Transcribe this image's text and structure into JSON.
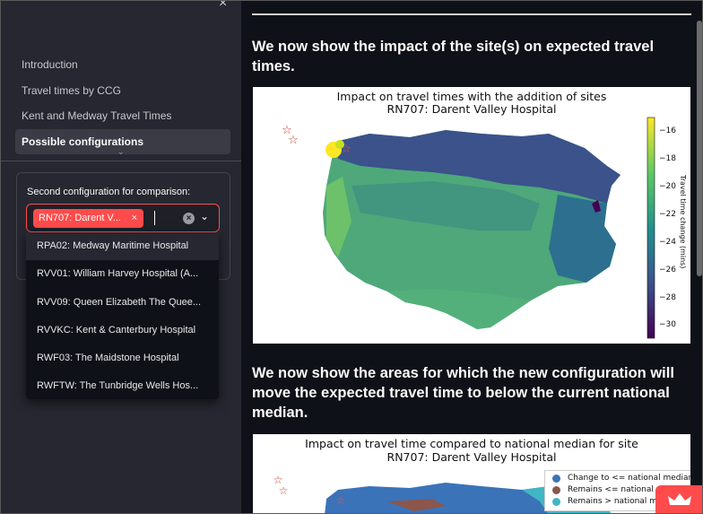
{
  "sidebar": {
    "close_glyph": "×",
    "nav": [
      {
        "label": "Introduction"
      },
      {
        "label": "Travel times by CCG"
      },
      {
        "label": "Kent and Medway Travel Times"
      },
      {
        "label": "Possible configurations",
        "active": true
      }
    ],
    "expand_glyph": "⌄",
    "comparison": {
      "label": "Second configuration for comparison:",
      "selected_tag": "RN707: Darent V...",
      "tag_remove": "×",
      "clear_glyph": "×",
      "chevron": "⌄"
    },
    "dropdown_options": [
      "RPA02: Medway Maritime Hospital",
      "RVV01: William Harvey Hospital (A...",
      "RVV09: Queen Elizabeth The Quee...",
      "RVVKC: Kent & Canterbury Hospital",
      "RWF03: The Maidstone Hospital",
      "RWFTW: The Tunbridge Wells Hos..."
    ]
  },
  "main": {
    "heading1": "We now show the impact of the site(s) on expected travel times.",
    "heading2": "We now show the areas for which the new configuration will move the expected travel time to below the current national median.",
    "figure1": {
      "title_line1": "Impact on travel times with the addition of sites",
      "title_line2": "RN707: Darent Valley Hospital",
      "colorbar_label": "Travel time change (mins)",
      "colorbar_ticks": [
        "−16",
        "−18",
        "−20",
        "−22",
        "−24",
        "−26",
        "−28",
        "−30"
      ],
      "colors": {
        "high": "#fde725",
        "mid": "#21918c",
        "low": "#440154"
      }
    },
    "figure2": {
      "title_line1": "Impact on travel time compared to national median for site",
      "title_line2": "RN707: Darent Valley Hospital",
      "legend": [
        {
          "label": "Change to <= national median",
          "color": "#3b73b9"
        },
        {
          "label": "Remains <= national median",
          "color": "#8c564b"
        },
        {
          "label": "Remains > national median",
          "color": "#41b6c4"
        }
      ]
    }
  }
}
